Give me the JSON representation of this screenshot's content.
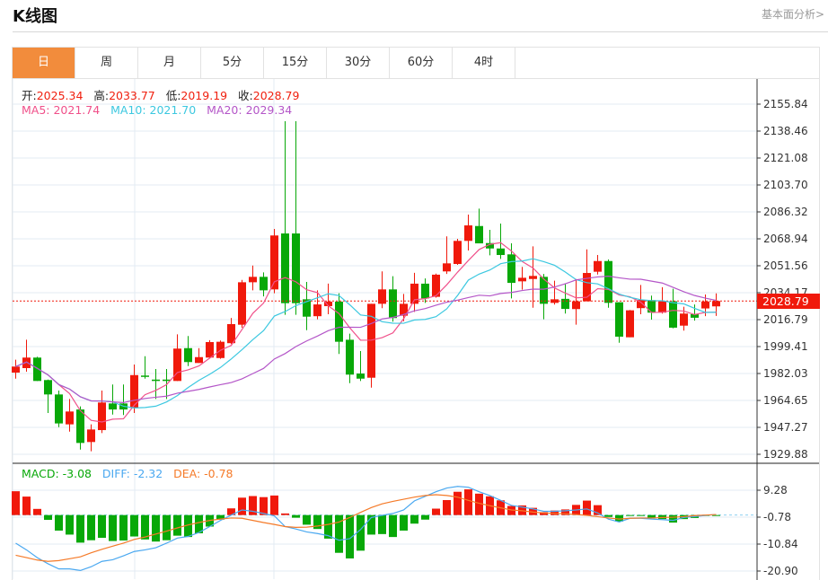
{
  "header": {
    "title": "K线图",
    "link": "基本面分析>"
  },
  "tabs": [
    {
      "label": "日",
      "active": true
    },
    {
      "label": "周"
    },
    {
      "label": "月"
    },
    {
      "label": "5分"
    },
    {
      "label": "15分"
    },
    {
      "label": "30分"
    },
    {
      "label": "60分"
    },
    {
      "label": "4时"
    }
  ],
  "ohlc_info": {
    "open_label": "开:",
    "open": "2025.34",
    "high_label": "高:",
    "high": "2033.77",
    "low_label": "低:",
    "low": "2019.19",
    "close_label": "收:",
    "close": "2028.79"
  },
  "ma_info": {
    "ma5": "MA5: 2021.74",
    "ma10": "MA10: 2021.70",
    "ma20": "MA20: 2029.34"
  },
  "macd_info": {
    "macd": "MACD: -3.08",
    "diff": "DIFF: -2.32",
    "dea": "DEA: -0.78"
  },
  "current_price": "2028.79",
  "colors": {
    "up": "#f0190b",
    "down": "#08a808",
    "ma5": "#f0508a",
    "ma10": "#3cc8e0",
    "ma20": "#b456c8",
    "diff": "#4aa8f0",
    "dea": "#f57a28",
    "active_tab": "#f28c3c"
  },
  "chart_data": [
    {
      "type": "candlestick",
      "y_ticks": [
        "2155.84",
        "2138.46",
        "2121.08",
        "2103.70",
        "2086.32",
        "2068.94",
        "2051.56",
        "2034.17",
        "2016.79",
        "1999.41",
        "1982.03",
        "1964.65",
        "1947.27",
        "1929.88"
      ],
      "ylim": [
        1929.88,
        2155.84
      ],
      "grid": true,
      "moving_averages": [
        5,
        10,
        20
      ],
      "ohlc": [
        [
          1982.6,
          1990.9,
          1978.7,
          1986.5
        ],
        [
          1985.5,
          2003.8,
          1983.2,
          1992.3
        ],
        [
          1992.3,
          1992.8,
          1977.2,
          1977.2
        ],
        [
          1977.8,
          1978.1,
          1956.5,
          1968.5
        ],
        [
          1968.5,
          1971.0,
          1947.4,
          1949.8
        ],
        [
          1949.2,
          1965.6,
          1944.5,
          1957.5
        ],
        [
          1958.8,
          1960.8,
          1932.9,
          1937.2
        ],
        [
          1937.8,
          1949.2,
          1931.8,
          1945.9
        ],
        [
          1945.5,
          1971.0,
          1943.6,
          1963.3
        ],
        [
          1962.7,
          1974.9,
          1955.5,
          1958.8
        ],
        [
          1962.7,
          1974.9,
          1955.2,
          1958.8
        ],
        [
          1959.8,
          1987.8,
          1956.5,
          1981.0
        ],
        [
          1980.7,
          1993.2,
          1978.7,
          1979.9
        ],
        [
          1978.1,
          1984.9,
          1965.6,
          1977.2
        ],
        [
          1978.1,
          1984.9,
          1965.6,
          1977.2
        ],
        [
          1977.2,
          2007.3,
          1977.2,
          1998.1
        ],
        [
          1998.4,
          2006.2,
          1986.8,
          1989.4
        ],
        [
          1988.8,
          1998.4,
          1988.8,
          1992.6
        ],
        [
          1992.3,
          2003.5,
          1991.7,
          2002.3
        ],
        [
          1992.0,
          2003.3,
          1991.5,
          2002.5
        ],
        [
          2001.6,
          2017.9,
          2001.0,
          2013.9
        ],
        [
          2013.5,
          2042.4,
          2011.6,
          2040.9
        ],
        [
          2040.9,
          2051.7,
          2035.7,
          2044.4
        ],
        [
          2044.4,
          2047.3,
          2031.8,
          2035.7
        ],
        [
          2036.3,
          2075.3,
          2033.8,
          2071.1
        ],
        [
          2072.4,
          2144.8,
          2019.9,
          2027.4
        ],
        [
          2072.4,
          2144.8,
          2019.9,
          2027.4
        ],
        [
          2029.9,
          2041.1,
          2010.0,
          2018.7
        ],
        [
          2019.0,
          2035.7,
          2017.0,
          2026.6
        ],
        [
          2025.5,
          2040.0,
          2020.3,
          2028.4
        ],
        [
          2028.4,
          2033.8,
          1994.6,
          2002.5
        ],
        [
          2003.8,
          2007.7,
          1975.8,
          1981.3
        ],
        [
          1982.0,
          1996.5,
          1977.2,
          1978.7
        ],
        [
          1979.3,
          2027.0,
          1972.9,
          2027.0
        ],
        [
          2027.0,
          2047.9,
          2024.2,
          2036.3
        ],
        [
          2036.3,
          2044.8,
          2015.5,
          2017.8
        ],
        [
          2019.3,
          2033.4,
          2015.8,
          2027.0
        ],
        [
          2027.0,
          2047.0,
          2021.8,
          2040.0
        ],
        [
          2040.0,
          2043.4,
          2027.6,
          2030.5
        ],
        [
          2031.5,
          2046.5,
          2031.0,
          2045.8
        ],
        [
          2047.9,
          2070.5,
          2046.3,
          2053.1
        ],
        [
          2052.7,
          2068.9,
          2052.1,
          2067.6
        ],
        [
          2067.6,
          2084.6,
          2061.4,
          2077.6
        ],
        [
          2077.2,
          2088.4,
          2066.0,
          2066.0
        ],
        [
          2066.2,
          2074.7,
          2058.3,
          2062.7
        ],
        [
          2062.7,
          2078.8,
          2056.0,
          2058.5
        ],
        [
          2058.9,
          2066.0,
          2030.5,
          2040.5
        ],
        [
          2041.5,
          2050.8,
          2036.1,
          2043.8
        ],
        [
          2043.0,
          2064.1,
          2024.5,
          2045.0
        ],
        [
          2044.4,
          2046.3,
          2017.0,
          2027.0
        ],
        [
          2027.6,
          2041.9,
          2026.5,
          2029.9
        ],
        [
          2030.2,
          2040.0,
          2020.7,
          2023.7
        ],
        [
          2023.6,
          2043.0,
          2013.5,
          2028.6
        ],
        [
          2028.6,
          2062.1,
          2028.6,
          2046.9
        ],
        [
          2047.7,
          2058.5,
          2045.9,
          2054.6
        ],
        [
          2054.6,
          2055.6,
          2024.5,
          2027.6
        ],
        [
          2028.0,
          2028.0,
          2001.9,
          2005.8
        ],
        [
          2005.4,
          2023.0,
          2005.4,
          2022.8
        ],
        [
          2024.2,
          2039.2,
          2020.3,
          2029.5
        ],
        [
          2029.4,
          2032.3,
          2016.8,
          2021.3
        ],
        [
          2021.3,
          2037.7,
          2020.7,
          2028.6
        ],
        [
          2028.6,
          2036.7,
          2011.2,
          2011.6
        ],
        [
          2012.9,
          2025.1,
          2009.7,
          2020.7
        ],
        [
          2020.3,
          2026.6,
          2016.1,
          2018.0
        ],
        [
          2024.0,
          2033.0,
          2019.0,
          2028.5
        ],
        [
          2025.34,
          2033.77,
          2019.19,
          2028.79
        ]
      ]
    },
    {
      "type": "bar+line",
      "y_ticks": [
        "9.28",
        "-0.78",
        "-10.84",
        "-20.90"
      ],
      "ylim": [
        -20.9,
        9.28
      ],
      "macd": [
        8.9,
        6.9,
        2.3,
        -1.8,
        -5.8,
        -7.3,
        -10.3,
        -9.4,
        -8.5,
        -9.7,
        -9.5,
        -8.0,
        -9.1,
        -9.9,
        -9.4,
        -7.7,
        -8.2,
        -6.8,
        -4.3,
        -1.7,
        2.5,
        6.5,
        7.1,
        6.7,
        7.3,
        0.6,
        -1.0,
        -3.6,
        -5.2,
        -8.8,
        -14.1,
        -16.2,
        -13.3,
        -7.3,
        -7.1,
        -8.2,
        -5.8,
        -3.2,
        -1.7,
        2.4,
        5.6,
        8.7,
        9.6,
        8.0,
        7.0,
        5.5,
        3.4,
        3.6,
        2.7,
        1.1,
        1.7,
        2.1,
        3.8,
        5.4,
        3.7,
        -0.7,
        -2.4,
        -0.3,
        -0.3,
        -1.2,
        -1.5,
        -2.8,
        -1.5,
        -1.1,
        -0.3,
        -0.2
      ],
      "diff": [
        -10.5,
        -13.0,
        -15.9,
        -18.2,
        -20.1,
        -20.1,
        -20.7,
        -19.3,
        -17.3,
        -16.7,
        -15.2,
        -13.6,
        -13.0,
        -12.2,
        -10.5,
        -8.6,
        -8.0,
        -6.5,
        -4.3,
        -2.0,
        0,
        1.9,
        1.4,
        0.6,
        -0.3,
        -4.3,
        -5.2,
        -6.3,
        -6.9,
        -7.7,
        -9.4,
        -8.8,
        -5.4,
        -0.9,
        -0.1,
        0.6,
        1.9,
        5.3,
        7.0,
        8.7,
        10.1,
        10.7,
        10.4,
        8.7,
        7.3,
        5.5,
        3.6,
        3.0,
        2.3,
        1.4,
        1.4,
        1.6,
        1.9,
        2.3,
        0.8,
        -1.5,
        -2.6,
        -1.2,
        -1.2,
        -1.5,
        -1.7,
        -2.0,
        -0.9,
        -0.6,
        -0.1,
        0.2
      ],
      "dea": [
        -15.0,
        -15.9,
        -16.8,
        -17.3,
        -17.0,
        -16.3,
        -15.6,
        -14.1,
        -12.8,
        -11.6,
        -10.5,
        -9.1,
        -8.2,
        -7.1,
        -6.0,
        -4.8,
        -3.7,
        -2.8,
        -2.0,
        -1.5,
        -1.1,
        -1.2,
        -2.0,
        -2.8,
        -3.5,
        -4.3,
        -4.6,
        -4.5,
        -4.1,
        -3.5,
        -2.6,
        -0.9,
        1.0,
        2.8,
        4.2,
        5.1,
        5.9,
        6.7,
        7.3,
        7.6,
        7.3,
        6.7,
        5.5,
        4.4,
        3.5,
        2.7,
        1.9,
        1.6,
        1.1,
        0.8,
        0.6,
        0.5,
        0.2,
        -0.1,
        -0.6,
        -1.1,
        -1.5,
        -1.2,
        -1.1,
        -1.1,
        -0.9,
        -0.8,
        -0.6,
        -0.2,
        0,
        0.2
      ]
    }
  ]
}
